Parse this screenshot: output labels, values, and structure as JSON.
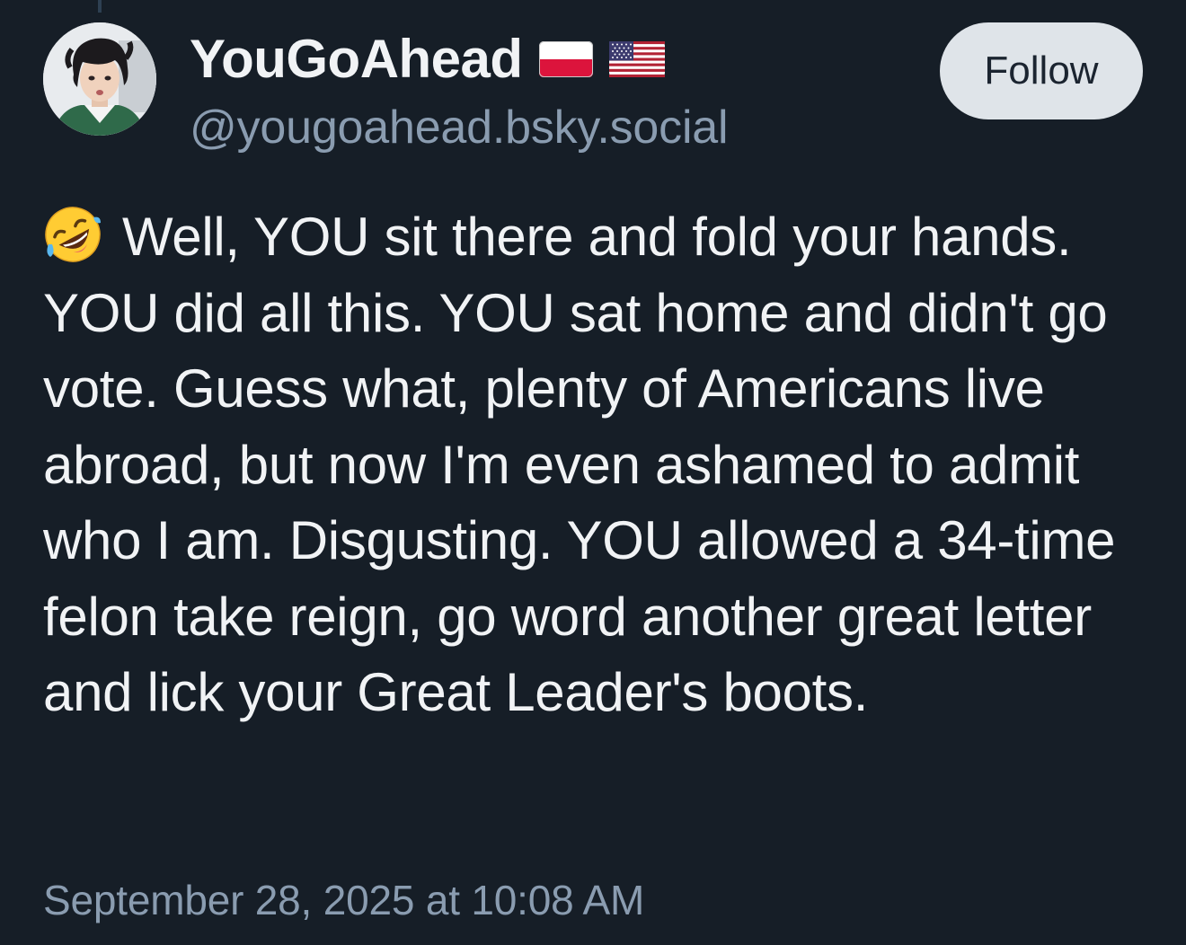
{
  "author": {
    "display_name": "YouGoAhead",
    "handle": "@yougoahead.bsky.social",
    "avatar_icon": "profile-photo",
    "flags": [
      "flag-poland-icon",
      "flag-usa-icon"
    ]
  },
  "actions": {
    "follow_label": "Follow"
  },
  "post": {
    "emoji_icon": "rolling-on-floor-laughing-emoji",
    "text": "Well, YOU sit there and fold your hands. YOU did all this. YOU sat home and didn't go vote. Guess what, plenty of Americans live abroad, but now I'm even ashamed to admit who I am. Disgusting. YOU allowed a 34-time felon take reign, go word another great letter and lick your Great Leader's boots.",
    "timestamp": "September 28, 2025 at 10:08 AM"
  },
  "colors": {
    "background": "#161e27",
    "primary_text": "#f1f3f5",
    "secondary_text": "#8a9cb0",
    "follow_button_bg": "#dfe4e9",
    "follow_button_text": "#1b2430"
  }
}
